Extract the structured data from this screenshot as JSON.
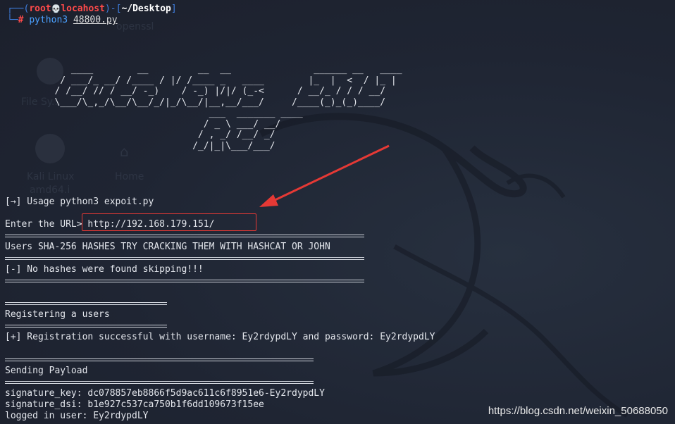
{
  "prompt": {
    "user": "root",
    "skull_glyph": "💀",
    "host": "locahost",
    "path": "~/Desktop",
    "hash_sign": "#",
    "command": "python3",
    "argument": "48800.py"
  },
  "banner_ascii": "            ____        __         __  __               ______ __   ____\n          / ___/_ __/ /____ / |/ /____ _   ____        |_  |  <  / |_ |\n         / /__/ // / __/ -_)    / -_) |/|/ (_-<      / __/_ / / / __/\n         \\___/\\_,_/\\__/\\__/_/|_/\\__/|__,__/___/     /____(_)_(_)____/\n                                     ___  _______ ____\n                                    / _ \\ ___/ __/\n                                   / , _/ /__/ _/\n                                  /_/|_|\\___/___/",
  "lines": {
    "usage": "[→] Usage python3 expoit.py",
    "url_prompt": "Enter the URL> ",
    "url_value": "http://192.168.179.151/",
    "hashes_title": "Users SHA-256 HASHES TRY CRACKING THEM WITH HASHCAT OR JOHN",
    "no_hashes": "[-] No hashes were found skipping!!!",
    "registering": "Registering a users",
    "registration": "[+] Registration successful with username: Ey2rdypdLY and password: Ey2rdypdLY",
    "sending": "Sending Payload",
    "signature_key": "signature_key: dc078857eb8866f5d9ac611c6f8951e6-Ey2rdypdLY",
    "signature_dsi": "signature_dsi: b1e927c537ca750b1f6dd109673f15ee",
    "logged_in": "logged in user: Ey2rdypdLY"
  },
  "background_icons": {
    "file_system": "File Sy...",
    "kali_linux": "Kali Linux",
    "amd64": "amd64.i",
    "home": "Home",
    "openssl": "openssl"
  },
  "watermark": "https://blog.csdn.net/weixin_50688050",
  "colors": {
    "background": "#1f2331",
    "prompt_blue": "#3f7fe0",
    "prompt_red": "#ff4a4a",
    "annotation_red": "#e53935",
    "text": "#e3e6ec"
  }
}
